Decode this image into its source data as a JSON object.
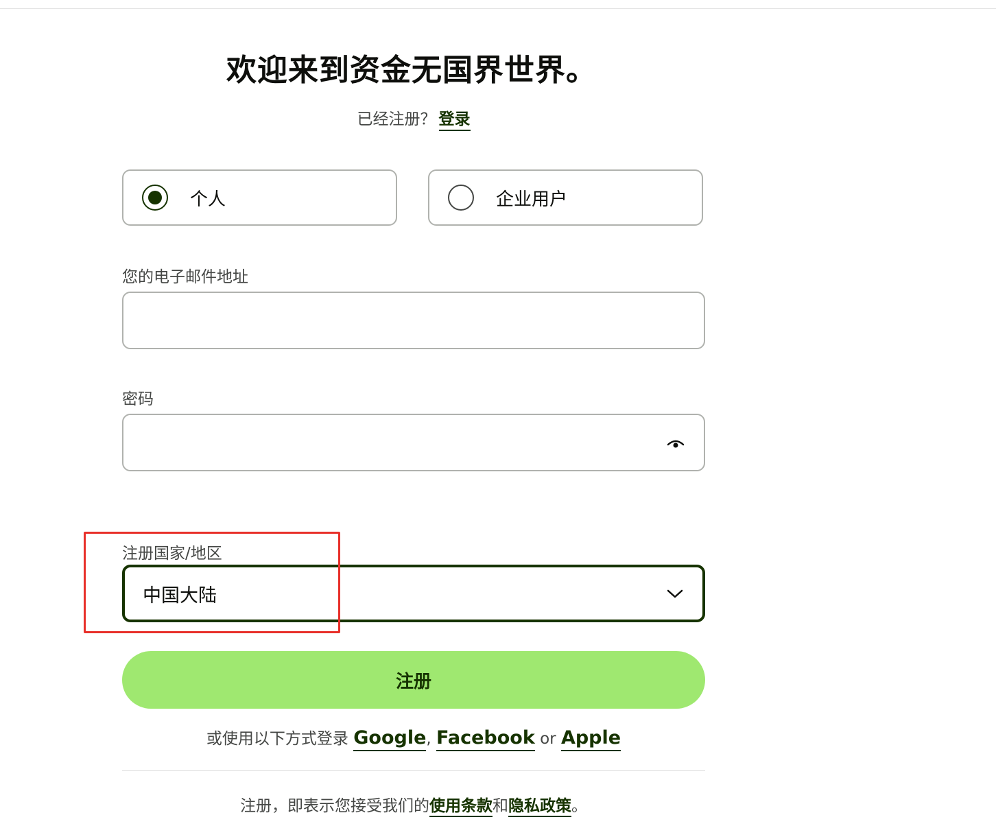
{
  "header": {
    "title": "欢迎来到资金无国界世界。",
    "already_registered": "已经注册？",
    "login_link": "登录"
  },
  "account_type": {
    "options": [
      {
        "label": "个人",
        "selected": true
      },
      {
        "label": "企业用户",
        "selected": false
      }
    ]
  },
  "email": {
    "label": "您的电子邮件地址",
    "value": ""
  },
  "password": {
    "label": "密码",
    "value": "",
    "toggle_icon": "eye-icon"
  },
  "country": {
    "label": "注册国家/地区",
    "selected": "中国大陆",
    "icon": "chevron-down-icon"
  },
  "register_button": "注册",
  "social_login": {
    "prefix": "或使用以下方式登录",
    "google": "Google",
    "comma": ",",
    "facebook": "Facebook",
    "or": "or",
    "apple": "Apple"
  },
  "terms": {
    "prefix": "注册，即表示您接受我们的",
    "terms_link": "使用条款",
    "and": "和",
    "privacy_link": "隐私政策",
    "suffix": "。"
  },
  "colors": {
    "brand_dark": "#163300",
    "brand_green": "#9fe870",
    "highlight": "#e8302a"
  }
}
